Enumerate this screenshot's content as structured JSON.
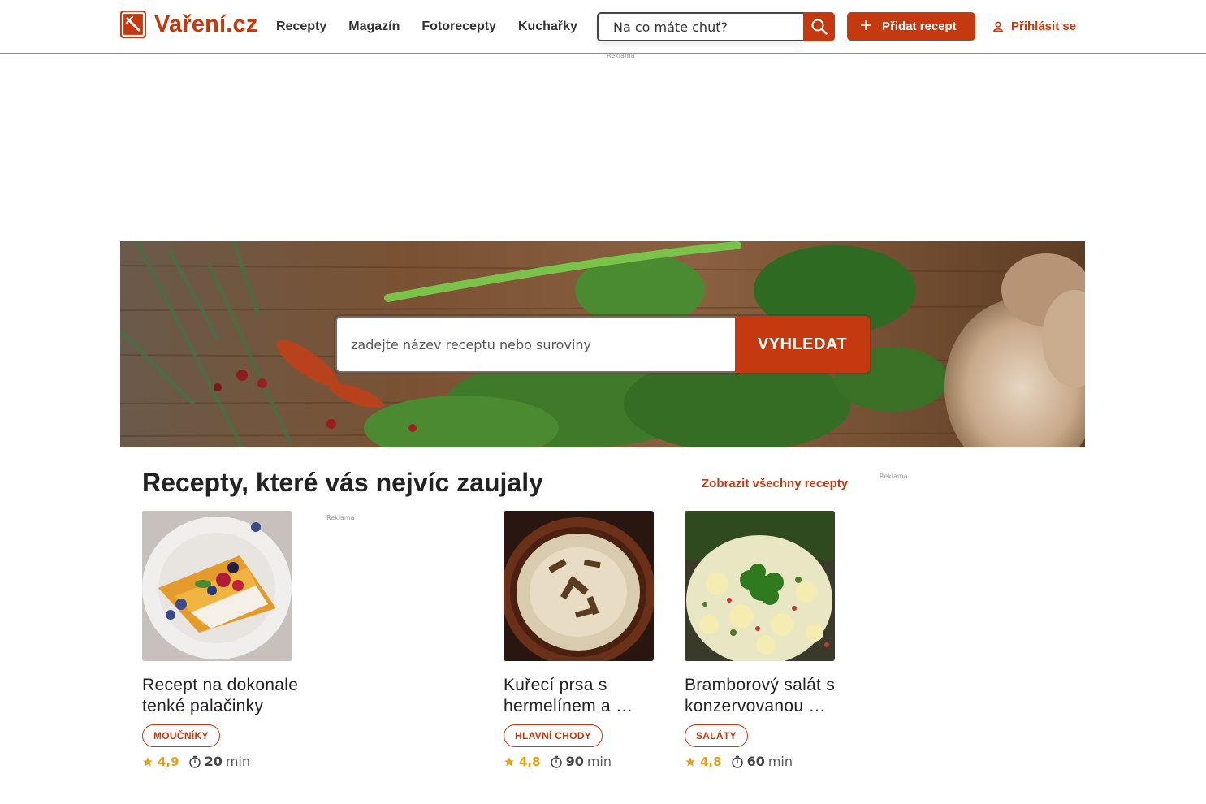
{
  "header": {
    "logo_text": "Vaření.cz",
    "nav": [
      "Recepty",
      "Magazín",
      "Fotorecepty",
      "Kuchařky"
    ],
    "search_placeholder": "Na co máte chuť?",
    "add_recipe": "Přidat recept",
    "login": "Přihlásit se"
  },
  "ads": {
    "label": "Reklama"
  },
  "hero": {
    "search_placeholder": "zadejte název receptu nebo suroviny",
    "search_button": "VYHLEDAT"
  },
  "section": {
    "title": "Recepty, které vás nejvíc zaujaly",
    "show_all": "Zobrazit všechny recepty"
  },
  "cards": [
    {
      "title": "Recept na dokonale tenké palačinky",
      "category": "MOUČNÍKY",
      "rating": "4,9",
      "time": "20",
      "time_unit": "min"
    },
    {
      "title": "Kuřecí prsa s hermelínem a …",
      "category": "HLAVNÍ CHODY",
      "rating": "4,8",
      "time": "90",
      "time_unit": "min"
    },
    {
      "title": "Bramborový salát s konzervovanou …",
      "category": "SALÁTY",
      "rating": "4,8",
      "time": "60",
      "time_unit": "min"
    }
  ],
  "colors": {
    "brand": "#c4390f",
    "rating": "#e6a020"
  }
}
